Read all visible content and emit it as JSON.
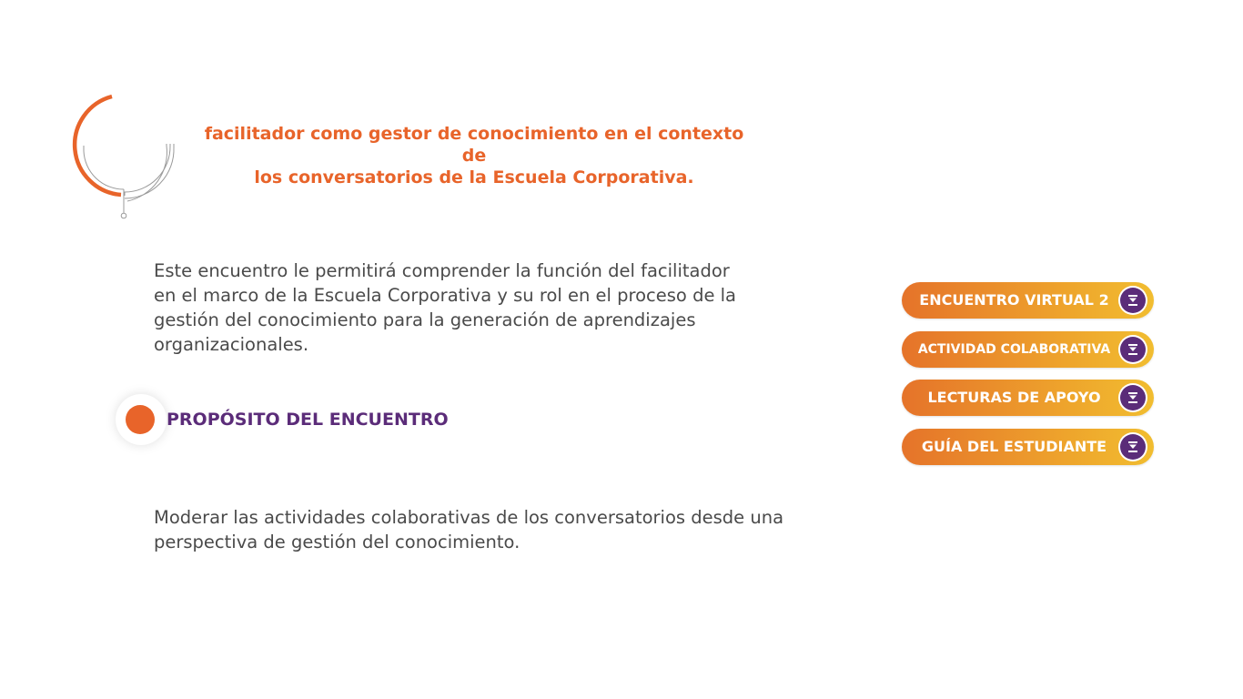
{
  "header": {
    "title_line1": "facilitador como gestor de conocimiento en el  contexto de",
    "title_line2": "los conversatorios de la Escuela Corporativa."
  },
  "intro": {
    "line1": "Este encuentro le permitirá comprender la función del facilitador",
    "line2": "en el marco de la Escuela Corporativa y su rol en el proceso de la",
    "line3": "gestión del conocimiento para la generación de aprendizajes",
    "line4": "organizacionales."
  },
  "purpose": {
    "heading": "PROPÓSITO DEL ENCUENTRO",
    "line1": "Moderar las actividades colaborativas de los conversatorios desde una",
    "line2": "perspectiva de gestión del conocimiento."
  },
  "menu": {
    "items": [
      {
        "label": "ENCUENTRO VIRTUAL 2",
        "icon": "chevron-down-icon"
      },
      {
        "label": "ACTIVIDAD COLABORATIVA",
        "icon": "chevron-down-icon"
      },
      {
        "label": "LECTURAS DE APOYO",
        "icon": "chevron-down-icon"
      },
      {
        "label": "GUÍA DEL ESTUDIANTE",
        "icon": "chevron-down-icon"
      }
    ]
  },
  "colors": {
    "accent_orange": "#e8642a",
    "accent_purple": "#5b2c79",
    "button_gradient_start": "#e5732a",
    "button_gradient_end": "#f1bd30",
    "body_text": "#4a4a4a"
  }
}
